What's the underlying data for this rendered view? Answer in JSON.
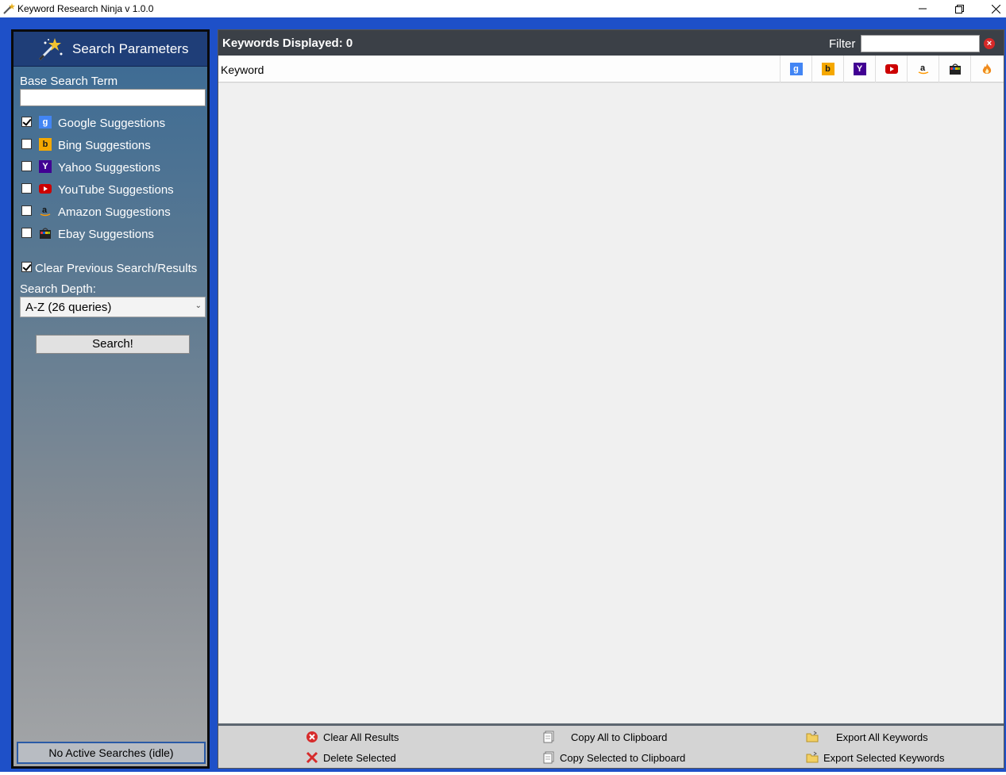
{
  "window": {
    "title": "Keyword Research Ninja v 1.0.0"
  },
  "left_panel": {
    "header_title": "Search Parameters",
    "base_search_label": "Base Search Term",
    "base_search_value": "",
    "sources": [
      {
        "label": "Google Suggestions",
        "checked": true,
        "icon": "google-icon",
        "color": "#4285f4"
      },
      {
        "label": "Bing Suggestions",
        "checked": false,
        "icon": "bing-icon",
        "color": "#f5a800"
      },
      {
        "label": "Yahoo Suggestions",
        "checked": false,
        "icon": "yahoo-icon",
        "color": "#410093"
      },
      {
        "label": "YouTube Suggestions",
        "checked": false,
        "icon": "youtube-icon",
        "color": "#cc0000"
      },
      {
        "label": "Amazon Suggestions",
        "checked": false,
        "icon": "amazon-icon",
        "color": "#ff9900"
      },
      {
        "label": "Ebay Suggestions",
        "checked": false,
        "icon": "ebay-icon",
        "color": "#e53238"
      }
    ],
    "clear_previous_label": "Clear Previous Search/Results",
    "clear_previous_checked": true,
    "search_depth_label": "Search Depth:",
    "search_depth_value": "A-Z (26 queries)",
    "search_button_label": "Search!",
    "status_text": "No Active Searches (idle)"
  },
  "right_panel": {
    "keywords_displayed": "Keywords Displayed: 0",
    "filter_label": "Filter",
    "filter_value": "",
    "column_keyword": "Keyword",
    "column_icons": [
      "google-icon",
      "bing-icon",
      "yahoo-icon",
      "youtube-icon",
      "amazon-icon",
      "ebay-icon",
      "fire-icon"
    ],
    "footer": {
      "clear_all": "Clear All Results",
      "delete_selected": "Delete Selected",
      "copy_all": "Copy All to Clipboard",
      "copy_selected": "Copy Selected to Clipboard",
      "export_all": "Export All Keywords",
      "export_selected": "Export Selected Keywords"
    }
  },
  "colors": {
    "workspace_blue": "#1e50c8",
    "panel_header": "#1f3e78",
    "right_header": "#3b4047"
  }
}
